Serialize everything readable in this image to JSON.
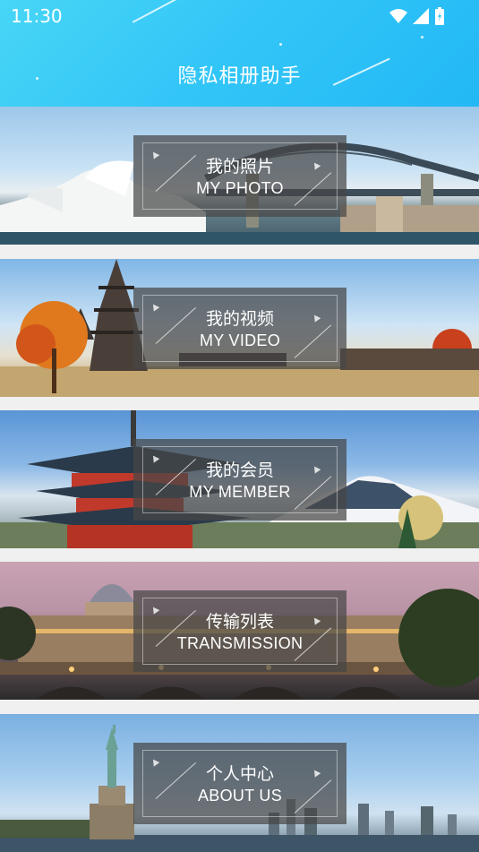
{
  "status_bar": {
    "time": "11:30"
  },
  "app": {
    "title": "隐私相册助手"
  },
  "menu": [
    {
      "cn": "我的照片",
      "en": "MY PHOTO"
    },
    {
      "cn": "我的视频",
      "en": "MY VIDEO"
    },
    {
      "cn": "我的会员",
      "en": "MY MEMBER"
    },
    {
      "cn": "传输列表",
      "en": "TRANSMISSION"
    },
    {
      "cn": "个人中心",
      "en": "ABOUT US"
    }
  ],
  "colors": {
    "header_start": "#48d6f6",
    "header_end": "#22b8f5",
    "overlay": "#464646"
  }
}
